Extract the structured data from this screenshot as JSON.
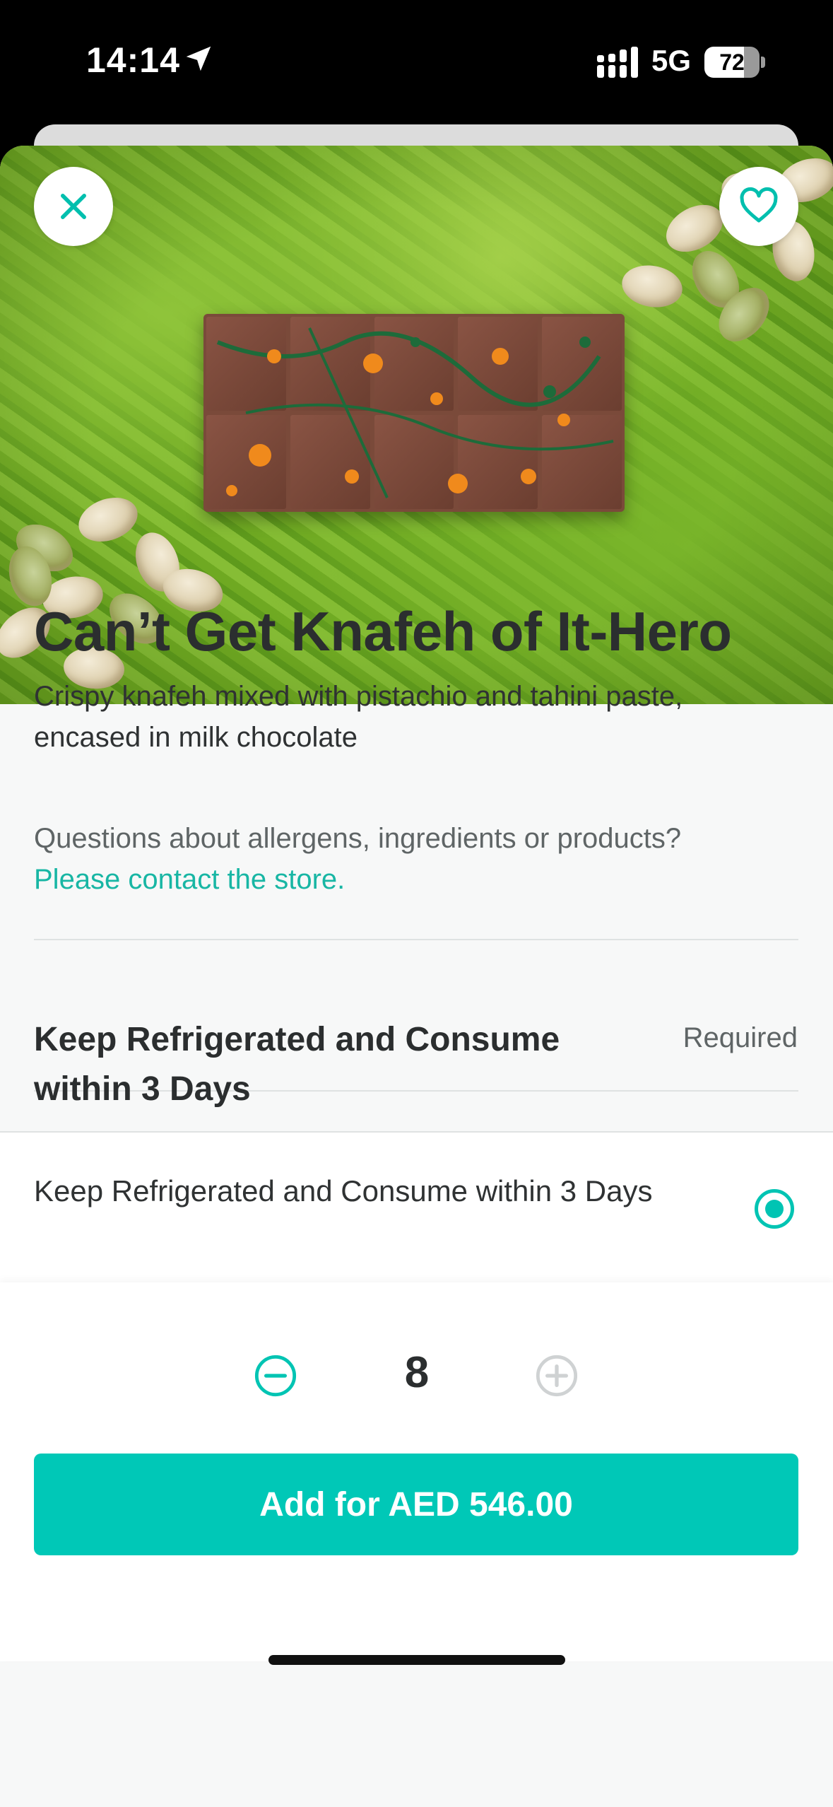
{
  "status_bar": {
    "time": "14:14",
    "network": "5G",
    "battery": "72",
    "battery_level": 0.72,
    "icons": [
      "location-arrow-icon",
      "signal-icon",
      "battery-icon"
    ]
  },
  "header": {
    "close_icon": "close-icon",
    "favorite_icon": "heart-icon",
    "hero_image": "chocolate-bar-on-pistachio-paste"
  },
  "product": {
    "title": "Can’t Get Knafeh of It-Hero",
    "description": "Crispy knafeh mixed with pistachio and tahini paste, encased in milk chocolate"
  },
  "allergens": {
    "question": "Questions about allergens, ingredients or products?",
    "link": "Please contact the store."
  },
  "option_group": {
    "title": "Keep Refrigerated and Consume within 3 Days",
    "required_label": "Required",
    "options": [
      {
        "label": "Keep Refrigerated and Consume within 3 Days",
        "selected": true
      }
    ]
  },
  "footer": {
    "quantity": "8",
    "minus_icon": "minus-circle-icon",
    "plus_icon": "plus-circle-icon",
    "add_button": "Add for AED 546.00"
  },
  "colors": {
    "accent": "#00c8b7",
    "link": "#18b6a4",
    "text": "#2b2e2f"
  }
}
